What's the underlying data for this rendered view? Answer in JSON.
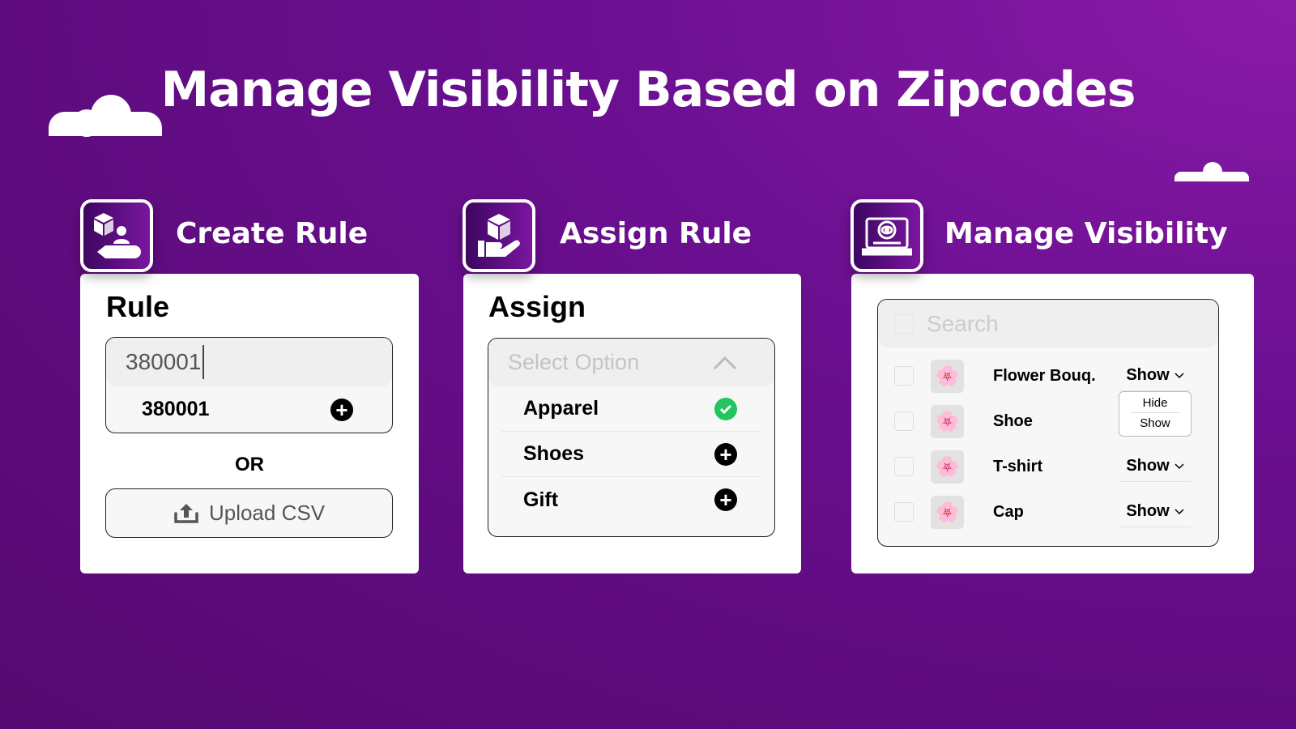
{
  "title": "Manage Visibility Based on Zipcodes",
  "sections": [
    {
      "title": "Create Rule",
      "icon": "box-user-pencil-icon"
    },
    {
      "title": "Assign Rule",
      "icon": "hand-box-icon"
    },
    {
      "title": "Manage Visibility",
      "icon": "laptop-gear-eye-icon"
    }
  ],
  "create": {
    "heading": "Rule",
    "input_value": "380001",
    "suggestion": "380001",
    "or": "OR",
    "upload_label": "Upload CSV"
  },
  "assign": {
    "heading": "Assign",
    "placeholder": "Select Option",
    "options": [
      {
        "label": "Apparel",
        "state": "selected"
      },
      {
        "label": "Shoes",
        "state": "add"
      },
      {
        "label": "Gift",
        "state": "add"
      }
    ]
  },
  "visibility": {
    "search_placeholder": "Search",
    "items": [
      {
        "name": "Flower Bouq.",
        "status": "Show"
      },
      {
        "name": "Shoe",
        "status": ""
      },
      {
        "name": "T-shirt",
        "status": "Show"
      },
      {
        "name": "Cap",
        "status": "Show"
      }
    ],
    "dropdown_options": [
      "Hide",
      "Show"
    ]
  },
  "colors": {
    "background": "#6a0f90",
    "check": "#22c55e"
  }
}
